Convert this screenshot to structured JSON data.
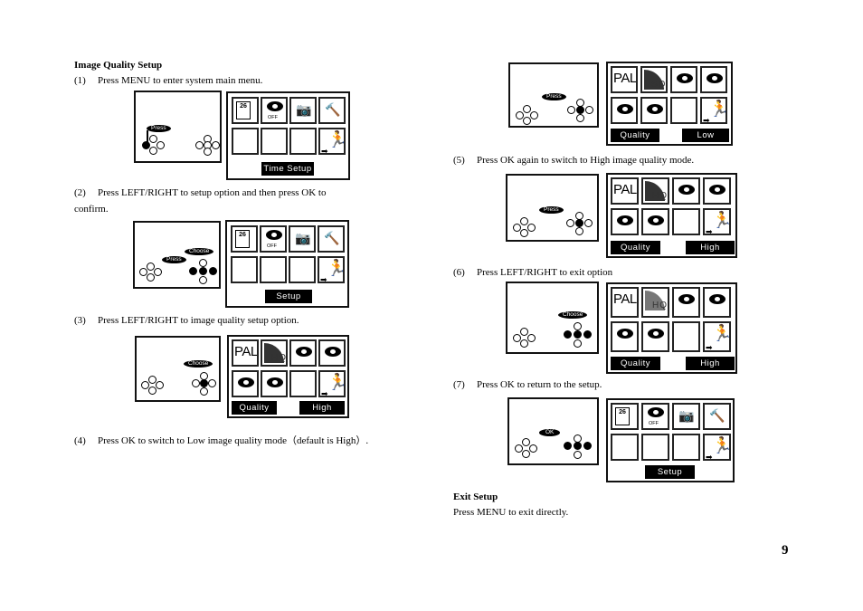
{
  "page": {
    "section_title": "Image Quality Setup",
    "page_number": "9",
    "steps": [
      {
        "num": "(1)",
        "text": "Press MENU to enter system main menu."
      },
      {
        "num": "(2)",
        "text": "Press LEFT/RIGHT to setup option and then press OK to",
        "text_cont": "confirm."
      },
      {
        "num": "(3)",
        "text": "Press LEFT/RIGHT to image quality setup option."
      },
      {
        "num": "(4)",
        "text": "Press OK to switch to Low image quality mode（default is High）."
      },
      {
        "num": "(5)",
        "text": "Press OK again to switch to High image quality mode."
      },
      {
        "num": "(6)",
        "text": "Press LEFT/RIGHT to exit option"
      },
      {
        "num": "(7)",
        "text": "Press OK to return to the setup."
      }
    ],
    "exit": {
      "title": "Exit Setup",
      "text": "Press MENU to exit directly."
    }
  },
  "figures": {
    "fig1": {
      "bubble": "Press",
      "screen_label": "Time  Setup",
      "cal_day": "26",
      "off": "OFF"
    },
    "fig2": {
      "bubble_a": "Press",
      "bubble_b": "Choose",
      "screen_label": "Setup",
      "cal_day": "26",
      "off": "OFF"
    },
    "fig3": {
      "bubble": "Choose",
      "left_label": "Quality",
      "right_label": "High",
      "pal": "PAL",
      "mode": "HQ"
    },
    "fig4": {
      "bubble": "Press",
      "left_label": "Quality",
      "right_label": "Low",
      "pal": "PAL",
      "mode": "SQ"
    },
    "fig5": {
      "bubble": "Press",
      "left_label": "Quality",
      "right_label": "High",
      "pal": "PAL",
      "mode": "HQ"
    },
    "fig6": {
      "bubble": "Choose",
      "left_label": "Quality",
      "right_label": "High",
      "pal": "PAL",
      "mode": "HQ"
    },
    "fig7": {
      "bubble": "OK",
      "screen_label": "Setup",
      "cal_day": "26",
      "off": "OFF"
    }
  }
}
